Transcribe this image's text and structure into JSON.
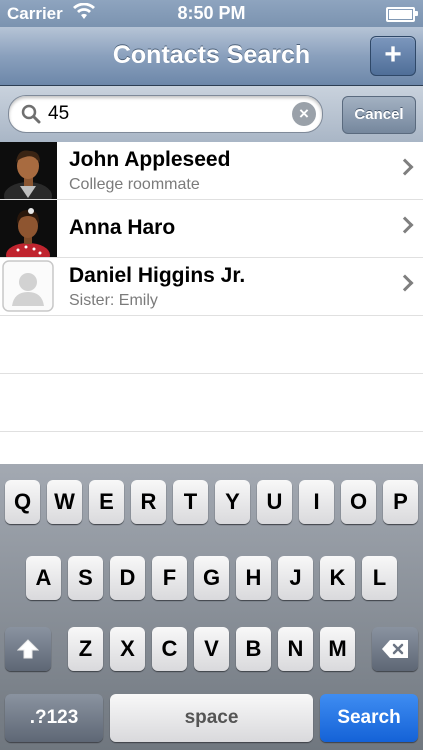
{
  "status_bar": {
    "carrier": "Carrier",
    "time": "8:50 PM"
  },
  "nav": {
    "title": "Contacts Search",
    "add_label": "+"
  },
  "search": {
    "value": "45",
    "clear_label": "×",
    "cancel_label": "Cancel"
  },
  "contacts": [
    {
      "name": "John Appleseed",
      "subtitle": "College roommate",
      "avatar": "male-photo"
    },
    {
      "name": "Anna Haro",
      "subtitle": "",
      "avatar": "female-photo"
    },
    {
      "name": "Daniel Higgins Jr.",
      "subtitle": "Sister: Emily",
      "avatar": "placeholder-silhouette"
    }
  ],
  "keyboard": {
    "row1": [
      "Q",
      "W",
      "E",
      "R",
      "T",
      "Y",
      "U",
      "I",
      "O",
      "P"
    ],
    "row2": [
      "A",
      "S",
      "D",
      "F",
      "G",
      "H",
      "J",
      "K",
      "L"
    ],
    "row3": [
      "Z",
      "X",
      "C",
      "V",
      "B",
      "N",
      "M"
    ],
    "shift_icon": "shift-arrow-icon",
    "delete_icon": "delete-backspace-icon",
    "numbers_label": ".?123",
    "space_label": "space",
    "search_label": "Search"
  },
  "colors": {
    "nav_bg": "#7b93b0",
    "search_key": "#1462d7"
  }
}
